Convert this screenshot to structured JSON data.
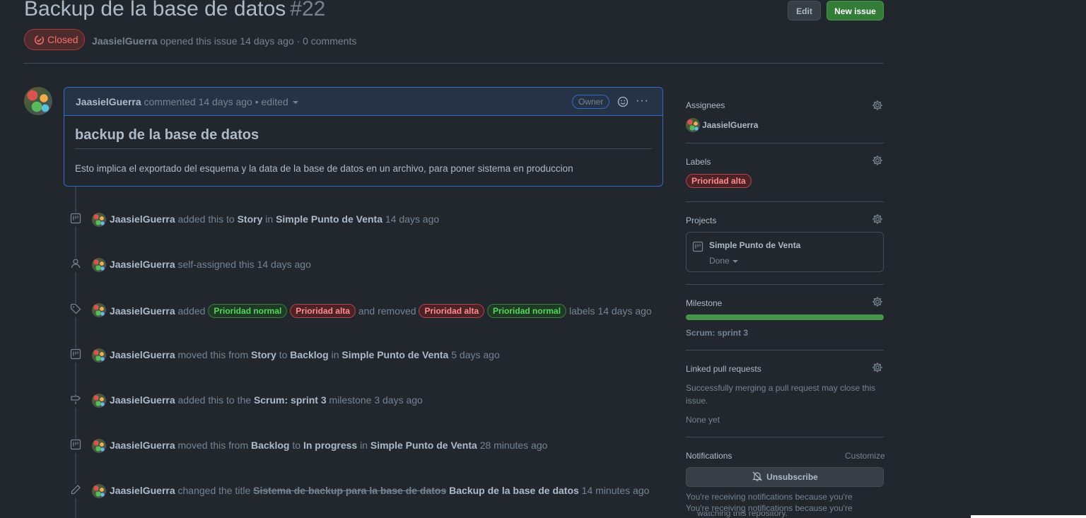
{
  "issue": {
    "title": "Backup de la base de datos",
    "number": "#22",
    "state": "Closed",
    "author": "JaasielGuerra",
    "opened_text": "opened this issue 14 days ago · 0 comments"
  },
  "header_buttons": {
    "edit": "Edit",
    "new_issue": "New issue"
  },
  "comment": {
    "author": "JaasielGuerra",
    "meta": "commented 14 days ago • edited",
    "role_badge": "Owner",
    "heading": "backup de la base de datos",
    "body": "Esto implica el exportado del esquema y la data de la base de datos en un archivo, para poner sistema en produccion"
  },
  "timeline": [
    {
      "icon": "project-icon",
      "actor": "JaasielGuerra",
      "t1": "added this to",
      "b1": "Story",
      "t2": "in",
      "b2": "Simple Punto de Venta",
      "time": "14 days ago"
    },
    {
      "icon": "person-icon",
      "actor": "JaasielGuerra",
      "t1": "self-assigned this",
      "time": "14 days ago"
    },
    {
      "icon": "tag-icon",
      "actor": "JaasielGuerra",
      "t1": "added",
      "added_labels": [
        "Prioridad normal",
        "Prioridad alta"
      ],
      "t2": "and removed",
      "removed_labels": [
        "Prioridad alta",
        "Prioridad normal"
      ],
      "t3": "labels",
      "time": "14 days ago"
    },
    {
      "icon": "project-icon",
      "actor": "JaasielGuerra",
      "t1": "moved this from",
      "b1": "Story",
      "t2": "to",
      "b2": "Backlog",
      "t3": "in",
      "b3": "Simple Punto de Venta",
      "time": "5 days ago"
    },
    {
      "icon": "milestone-icon",
      "actor": "JaasielGuerra",
      "t1": "added this to the",
      "b1": "Scrum: sprint 3",
      "t2": "milestone",
      "time": "3 days ago"
    },
    {
      "icon": "project-icon",
      "actor": "JaasielGuerra",
      "t1": "moved this from",
      "b1": "Backlog",
      "t2": "to",
      "b2": "In progress",
      "t3": "in",
      "b3": "Simple Punto de Venta",
      "time": "28 minutes ago"
    },
    {
      "icon": "pencil-icon",
      "actor": "JaasielGuerra",
      "t1": "changed the title",
      "old_title": "Sistema de backup para la base de datos",
      "new_title": "Backup de la base de datos",
      "time": "14 minutes ago"
    }
  ],
  "sidebar": {
    "assignees": {
      "heading": "Assignees",
      "user": "JaasielGuerra"
    },
    "labels": {
      "heading": "Labels",
      "items": [
        "Prioridad alta"
      ]
    },
    "projects": {
      "heading": "Projects",
      "name": "Simple Punto de Venta",
      "status": "Done"
    },
    "milestone": {
      "heading": "Milestone",
      "name": "Scrum: sprint 3",
      "progress": 1.0
    },
    "linked_prs": {
      "heading": "Linked pull requests",
      "description": "Successfully merging a pull request may close this issue.",
      "none": "None yet"
    },
    "notifications": {
      "heading": "Notifications",
      "customize": "Customize",
      "button": "Unsubscribe",
      "reason": "You're receiving notifications because you're",
      "reason_repeat": "You're receiving notifications because you're",
      "reason_cut": "watching this repository."
    }
  },
  "colors": {
    "background": "#22272e",
    "closed": "#f47067",
    "primary": "#347d39",
    "accent_border": "#316dca"
  }
}
